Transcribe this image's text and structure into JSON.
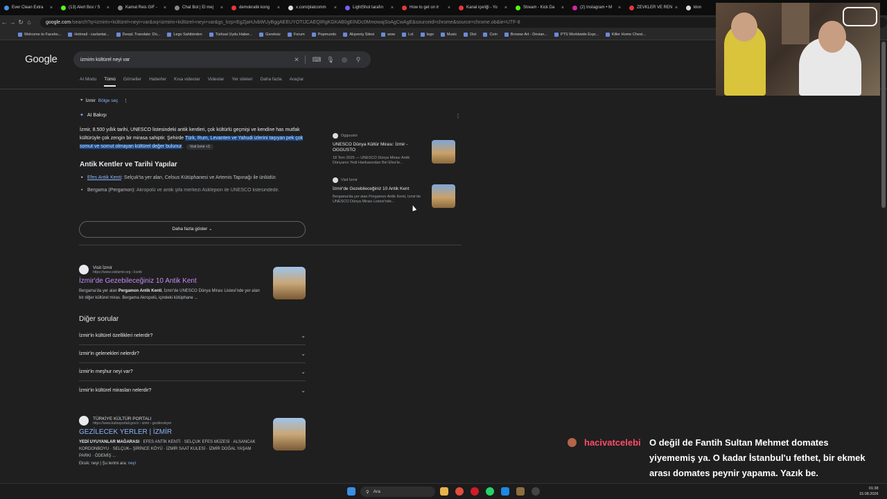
{
  "tabs": [
    {
      "label": "Ever Clean Extra",
      "color": "#4a90e2"
    },
    {
      "label": "(13) Alert Box / S",
      "color": "#53fc18"
    },
    {
      "label": "Kamal Reis GIF -",
      "color": "#888888"
    },
    {
      "label": "Chat Bot | El mej",
      "color": "#888888"
    },
    {
      "label": "demokratik kong",
      "color": "#e53935"
    },
    {
      "label": "x.com/platcomm",
      "color": "#dddddd"
    },
    {
      "label": "LightShot tarafın",
      "color": "#7a5cff"
    },
    {
      "label": "How to get on tr",
      "color": "#e53935"
    },
    {
      "label": "Kanal içeriği - Yo",
      "color": "#e53935"
    },
    {
      "label": "Stream - Kick Da",
      "color": "#53fc18"
    },
    {
      "label": "(2) Instagram • M",
      "color": "#d6249f"
    },
    {
      "label": "ZEVKLER VE REN",
      "color": "#e53935"
    },
    {
      "label": "klon",
      "color": "#dddddd"
    }
  ],
  "address": {
    "host": "google.com",
    "rest": "/search?q=izmirin+kültürel+neyi+var&oq=izmirin+kültürel+neyi+var&gs_lcrp=EgZjaHJvbWUyBggAEEUYOTIJCAEQIRgKGKAB0gEINDc0MmowajSoAgCwAgE&sourceid=chrome&source=chrome.ob&ie=UTF-8"
  },
  "bookmarks": [
    "Welcome to Facebo...",
    "Hotmail - cavlantat...",
    "DeepL Translate: Dü...",
    "Lego Sahibinden",
    "Türksat Uydu Haber...",
    "Gereksiz",
    "Forum",
    "Popmundo",
    "Alışveriş Sitesi",
    "wow",
    "Lol",
    "lego",
    "Music",
    "Dizi",
    "Coin",
    "Browse Art - Devian...",
    "PTS Worldwide Expr...",
    "Killer Home Chest..."
  ],
  "google": {
    "logo": "Google",
    "query": "izmirin kültürel neyi var",
    "tabs": [
      "AI Modu",
      "Tümü",
      "Görseller",
      "Haberler",
      "Kısa videolar",
      "Videolar",
      "Yer siteleri",
      "Daha fazla",
      "Araçlar"
    ],
    "active_tab": "Tümü",
    "location": {
      "place": "İzmir",
      "action": "Bölge seç"
    }
  },
  "ai": {
    "heading": "AI Bakışı",
    "text_plain": "İzmir, 8.500 yıllık tarihi, UNESCO listesindeki antik kentleri, çok kültürlü geçmişi ve kendine has mutfak kültürüyle çok zengin bir mirasa sahiptir. Şehirde ",
    "text_highlight": "Türk, Rum, Levanten ve Yahudi izlerini taşıyan pek çok somut ve somut olmayan kültürel değer bulunur",
    "text_end": ".",
    "chip": "Visit İzmir +3",
    "subheading": "Antik Kentler ve Tarihi Yapılar",
    "bullets": [
      {
        "link": "Efes Antik Kenti",
        "rest": ": Selçuk'ta yer alan, Celsus Kütüphanesi ve Artemis Tapınağı ile ünlüdür."
      },
      {
        "bold": "Bergama (Pergamon)",
        "rest": ": Akropolü ve antik şifa merkezi Asklepion ile UNESCO listesindedir."
      }
    ],
    "more_label": "Daha fazla göster",
    "cards": [
      {
        "source": "Ogguusto",
        "title": "UNESCO Dünya Kültür Mirası: İzmir - OGGUSTO",
        "snippet": "18 Tem 2025 — UNESCO Dünya Mirası Antik Dünyanın Yedi Harikasından Biri Efes'te..."
      },
      {
        "source": "Visit İzmir",
        "title": "İzmir'de Gezebileceğiniz 10 Antik Kent",
        "snippet": "Bergama'da yer alan Pergamon Antik Kenti, İzmir'de UNESCO Dünya Mirası Listesi'nde..."
      }
    ]
  },
  "results": [
    {
      "site": "Visit İzmir",
      "url": "https://www.visitizmir.org › İcerik",
      "title": "İzmir'de Gezebileceğiniz 10 Antik Kent",
      "snippet_pre": "Bergama'da yer alan ",
      "snippet_bold": "Pergamon Antik Kenti",
      "snippet_post": ", İzmir'de UNESCO Dünya Mirası Listesi'nde yer alan bir diğer kültürel miras. Bergama Akropolü, içindeki kütüphane ..."
    },
    {
      "site": "TÜRKİYE KÜLTÜR PORTALI",
      "url": "https://www.kulturportali.gov.tr › izmir › gezilecekyer",
      "title": "GEZİLECEK YERLER | İZMİR",
      "snippet_bold": "YEDİ UYUYANLAR MAĞARASI",
      "snippet_post": " · EFES ANTİK KENTİ · SELÇUK EFES MÜZESİ · ALSANCAK KORDONBOYU · SELÇUK– ŞİRİNCE KÖYÜ · İZMİR SAAT KULESİ · İZMİR DOĞAL YAŞAM PARKI · ÖDEMİŞ ...",
      "missing": "Eksik: neyi | Şu terimi ara: ",
      "missing_link": "neyi"
    }
  ],
  "paa": {
    "heading": "Diğer sorular",
    "questions": [
      "İzmir'in kültürel özellikleri nelerdir?",
      "İzmir'in gelenekleri nelerdir?",
      "İzmir'in meşhur neyi var?",
      "İzmir'in kültürel mirasları nelerdir?"
    ]
  },
  "chat": {
    "user": "hacivatcelebi",
    "message": "O değil de Fantih Sultan Mehmet domates yiyememiş ya. O kadar İstanbul'u fethet, bir ekmek arası domates peynir yapama. Yazık be."
  },
  "taskbar": {
    "search_placeholder": "Ara",
    "time": "01:38",
    "date": "15.08.2026"
  }
}
